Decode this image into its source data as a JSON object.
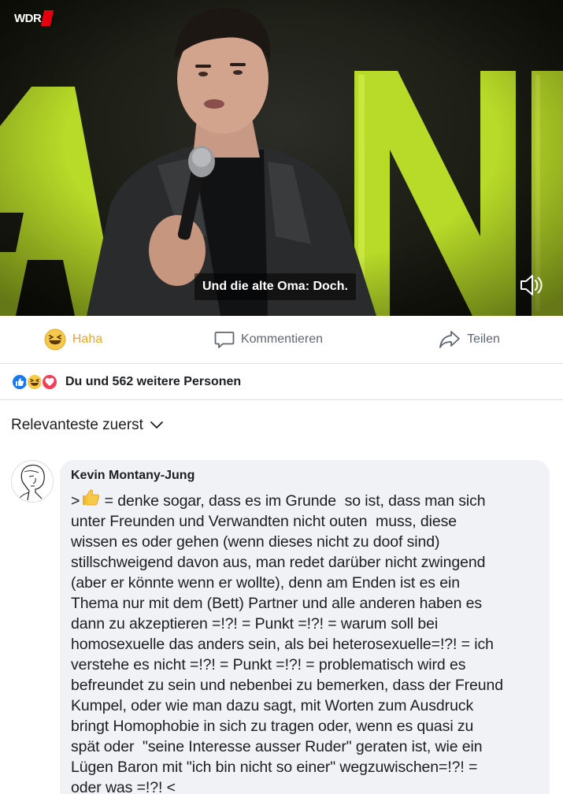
{
  "video": {
    "channel_logo": "WDR",
    "subtitle": "Und die alte Oma: Doch.",
    "stage_letters_color": "#c6ea2a",
    "volume_icon": "speaker-muted-icon"
  },
  "actions": {
    "haha_label": "Haha",
    "haha_color": "#e3a82d",
    "comment_label": "Kommentieren",
    "share_label": "Teilen"
  },
  "reactions": {
    "icons": [
      "like-icon",
      "haha-icon",
      "love-icon"
    ],
    "text": "Du und 562 weitere Personen"
  },
  "sort": {
    "label": "Relevanteste zuerst"
  },
  "comment": {
    "author": "Kevin Montany-Jung",
    "prefix": ">",
    "lines": [
      " = denke sogar, dass es im Grunde  so ist, dass man sich",
      "unter Freunden und Verwandten nicht outen  muss, diese",
      "wissen es oder gehen (wenn dieses nicht zu doof sind)",
      "stillschweigend davon aus, man redet darüber nicht zwingend",
      "(aber er könnte wenn er wollte), denn am Enden ist es ein",
      "Thema nur mit dem (Bett) Partner und alle anderen haben es",
      "dann zu akzeptieren =!?! = Punkt =!?! = warum soll bei",
      "homosexuelle das anders sein, als bei heterosexuelle=!?! = ich",
      "verstehe es nicht =!?! = Punkt =!?! = problematisch wird es",
      "befreundet zu sein und nebenbei zu bemerken, dass der Freund",
      "Kumpel, oder wie man dazu sagt, mit Worten zum Ausdruck",
      "bringt Homophobie in sich zu tragen oder, wenn es quasi zu",
      "spät oder  \"seine Interesse ausser Ruder\" geraten ist, wie ein",
      "Lügen Baron mit \"ich bin nicht so einer\" wegzuwischen=!?! =",
      "oder was =!?! <"
    ]
  }
}
